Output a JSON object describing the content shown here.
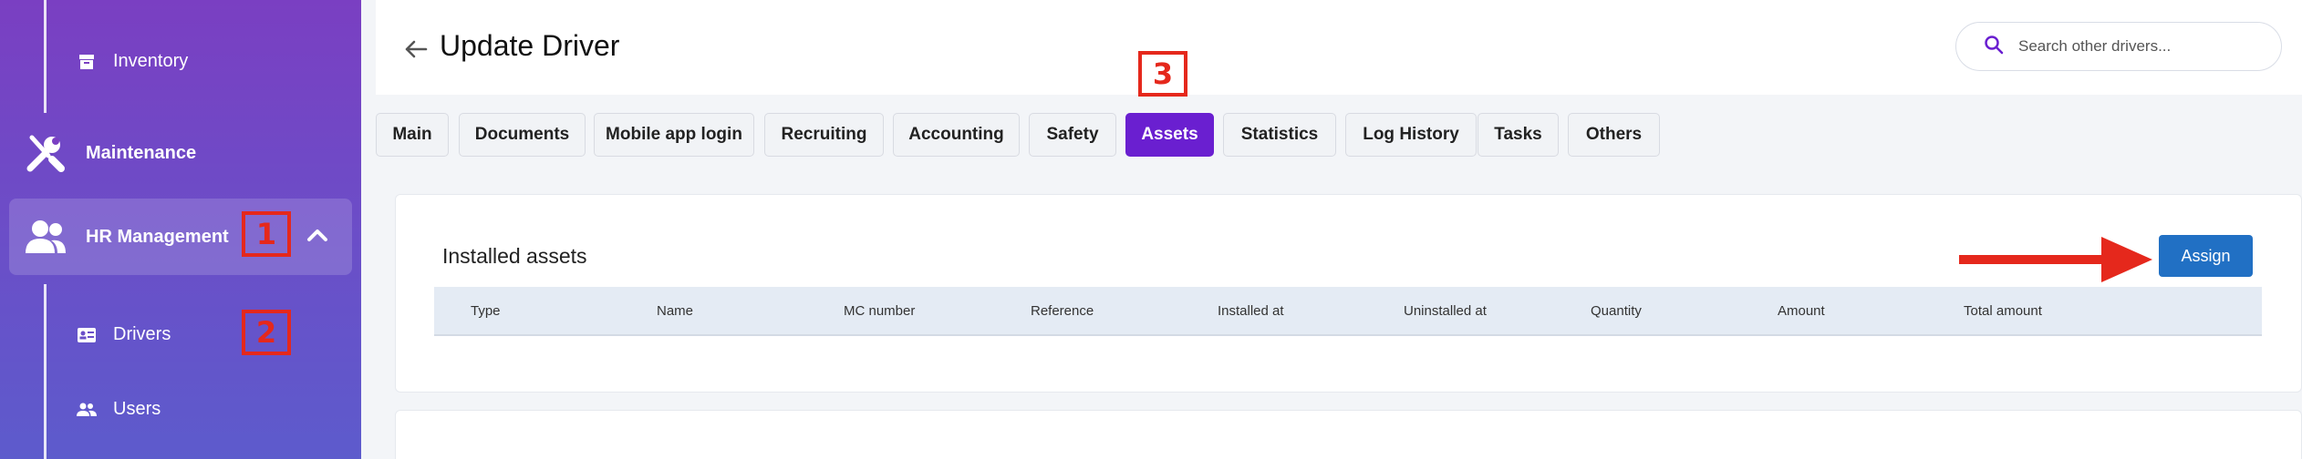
{
  "sidebar": {
    "inventory_label": "Inventory",
    "maintenance_label": "Maintenance",
    "hr_label": "HR Management",
    "drivers_label": "Drivers",
    "users_label": "Users",
    "icons": [
      "archive-box-icon",
      "wrench-screwdriver-icon",
      "people-icon",
      "id-card-icon",
      "users-icon",
      "chevron-up-icon"
    ]
  },
  "annotations": {
    "one": "1",
    "two": "2",
    "three": "3",
    "color": "#e5281c"
  },
  "header": {
    "title": "Update Driver",
    "search_placeholder": "Search other drivers..."
  },
  "tabs": [
    {
      "label": "Main"
    },
    {
      "label": "Documents"
    },
    {
      "label": "Mobile app login"
    },
    {
      "label": "Recruiting"
    },
    {
      "label": "Accounting"
    },
    {
      "label": "Safety"
    },
    {
      "label": "Assets",
      "active": true
    },
    {
      "label": "Statistics"
    },
    {
      "label": "Log History"
    },
    {
      "label": "Tasks"
    },
    {
      "label": "Others"
    }
  ],
  "assets": {
    "title": "Installed assets",
    "assign_label": "Assign",
    "columns": [
      "Type",
      "Name",
      "MC number",
      "Reference",
      "Installed at",
      "Uninstalled at",
      "Quantity",
      "Amount",
      "Total amount"
    ]
  },
  "colors": {
    "accent": "#6a1fd0",
    "assign_button": "#2170c4",
    "sidebar_top": "#7a3fc2",
    "sidebar_bottom": "#5d5bcc"
  }
}
